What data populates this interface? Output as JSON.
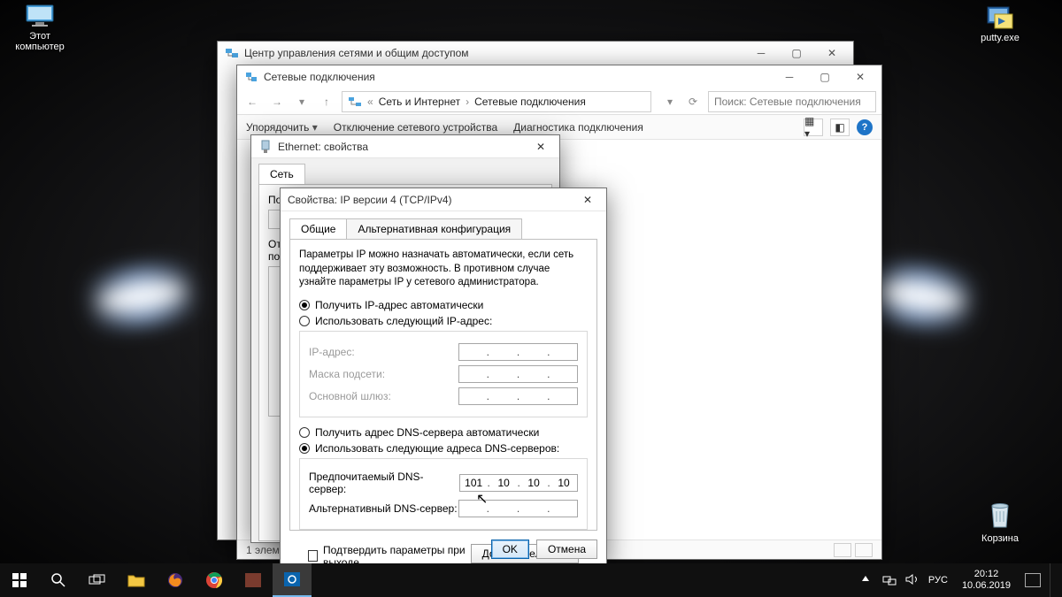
{
  "desktop": {
    "this_pc": "Этот компьютер",
    "putty": "putty.exe",
    "recycle": "Корзина"
  },
  "cp": {
    "title": "Центр управления сетями и общим доступом"
  },
  "nc": {
    "title": "Сетевые подключения",
    "crumb1": "Сеть и Интернет",
    "crumb2": "Сетевые подключения",
    "search_placeholder": "Поиск: Сетевые подключения",
    "cmd_organize": "Упорядочить",
    "cmd_disable": "Отключение сетевого устройства",
    "cmd_diag": "Диагностика подключения",
    "status": "1 элемент"
  },
  "eth": {
    "title": "Ethernet: свойства",
    "tab_network": "Сеть",
    "lbl_connect_using": "Подключение через:",
    "lbl_components": "Отмеченные компоненты используются этим подключением:"
  },
  "ip": {
    "title": "Свойства: IP версии 4 (TCP/IPv4)",
    "tab_general": "Общие",
    "tab_alt": "Альтернативная конфигурация",
    "help": "Параметры IP можно назначать автоматически, если сеть поддерживает эту возможность. В противном случае узнайте параметры IP у сетевого администратора.",
    "r_auto_ip": "Получить IP-адрес автоматически",
    "r_manual_ip": "Использовать следующий IP-адрес:",
    "f_ip": "IP-адрес:",
    "f_mask": "Маска подсети:",
    "f_gw": "Основной шлюз:",
    "r_auto_dns": "Получить адрес DNS-сервера автоматически",
    "r_manual_dns": "Использовать следующие адреса DNS-серверов:",
    "f_dns1": "Предпочитаемый DNS-сервер:",
    "f_dns2": "Альтернативный DNS-сервер:",
    "dns1": {
      "o1": "101",
      "o2": "10",
      "o3": "10",
      "o4": "10"
    },
    "chk_validate": "Подтвердить параметры при выходе",
    "btn_adv": "Дополнительно...",
    "btn_ok": "OK",
    "btn_cancel": "Отмена"
  },
  "taskbar": {
    "lang": "РУС",
    "time": "20:12",
    "date": "10.06.2019"
  }
}
